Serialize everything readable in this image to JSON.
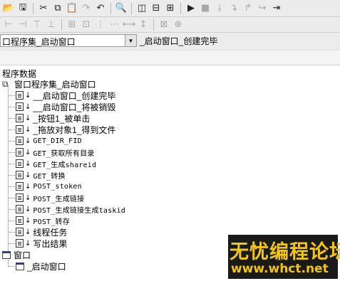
{
  "toolbar_primary": {
    "icons": [
      "open-folder-icon",
      "save-icon",
      "cut-icon",
      "copy-icon",
      "paste-icon",
      "redo-icon",
      "undo-icon",
      "find-icon",
      "layout-icon",
      "layout2-icon",
      "window-list-icon",
      "run-icon",
      "stop-icon",
      "step-icon",
      "step-into-icon",
      "step-out-icon",
      "step-over-icon",
      "run-to-cursor-icon"
    ]
  },
  "toolbar_alignment": {
    "icons": [
      "align-left-icon",
      "align-right-icon",
      "align-top-icon",
      "align-bottom-icon",
      "center-horizontal-icon",
      "center-vertical-icon",
      "space-horizontal-icon",
      "space-vertical-icon",
      "same-width-icon",
      "same-height-icon",
      "same-size-icon",
      "spread-icon"
    ]
  },
  "selector": {
    "assembly_value": "口程序集_启动窗口",
    "event_value": "_启动窗口_创建完毕"
  },
  "tree": {
    "header": "程序数据",
    "assembly_label": "窗口程序集_启动窗口",
    "subroutines": [
      "__启动窗口_创建完毕",
      "__启动窗口_将被销毁",
      "_按钮1_被单击",
      "_拖放对象1_得到文件",
      "GET_DIR_FID",
      "GET_获取所有目录",
      "GET_生成shareid",
      "GET_转换",
      "POST_stoken",
      "POST_生成链接",
      "POST_生成链接生成taskid",
      "POST_转存",
      "线程任务",
      "写出结果"
    ],
    "windows_label": "窗口",
    "window_item": "_启动窗口"
  },
  "watermark": {
    "title": "无忧编程论坛",
    "url": "www.whct.net"
  }
}
